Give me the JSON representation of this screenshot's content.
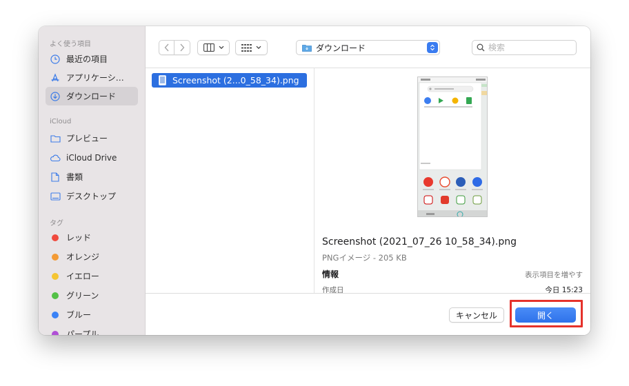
{
  "sidebar": {
    "favorites_header": "よく使う項目",
    "favorites": [
      {
        "label": "最近の項目",
        "icon": "clock-icon"
      },
      {
        "label": "アプリケーシ…",
        "icon": "applications-icon"
      },
      {
        "label": "ダウンロード",
        "icon": "download-icon"
      }
    ],
    "icloud_header": "iCloud",
    "icloud": [
      {
        "label": "プレビュー",
        "icon": "folder-icon"
      },
      {
        "label": "iCloud Drive",
        "icon": "cloud-icon"
      },
      {
        "label": "書類",
        "icon": "document-icon"
      },
      {
        "label": "デスクトップ",
        "icon": "desktop-icon"
      }
    ],
    "tags_header": "タグ",
    "tags": [
      {
        "label": "レッド",
        "color": "#f04a3e"
      },
      {
        "label": "オレンジ",
        "color": "#f39a35"
      },
      {
        "label": "イエロー",
        "color": "#f5c533"
      },
      {
        "label": "グリーン",
        "color": "#53c146"
      },
      {
        "label": "ブルー",
        "color": "#3b82f6"
      },
      {
        "label": "パープル",
        "color": "#b04fd6"
      }
    ]
  },
  "toolbar": {
    "location": "ダウンロード",
    "search_placeholder": "検索"
  },
  "files": [
    {
      "name": "Screenshot (2...0_58_34).png"
    }
  ],
  "preview": {
    "filename": "Screenshot (2021_07_26 10_58_34).png",
    "kind": "PNGイメージ - 205 KB",
    "info_label": "情報",
    "show_more": "表示項目を増やす",
    "created_label": "作成日",
    "created_value": "今日 15:23"
  },
  "buttons": {
    "cancel": "キャンセル",
    "open": "開く"
  },
  "colors": {
    "accent": "#2c6fe0",
    "highlight": "#e5322b"
  }
}
